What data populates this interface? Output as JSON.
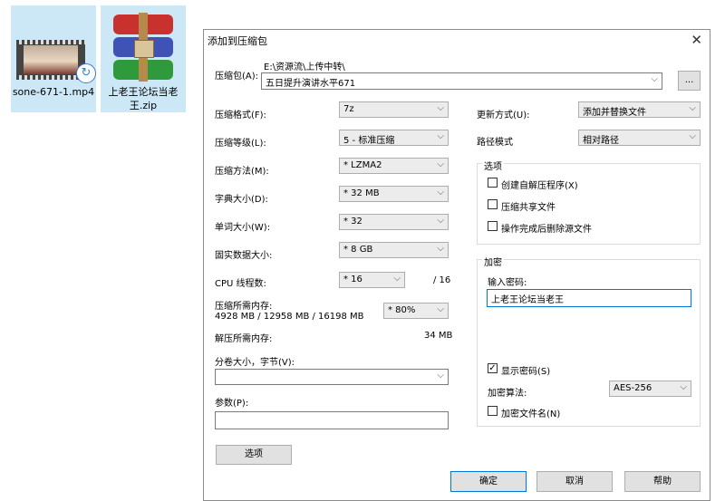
{
  "desktop": {
    "video_file": "sone-671-1.mp4",
    "zip_file": "上老王论坛当老王.zip"
  },
  "dialog": {
    "title": "添加到压缩包",
    "close_glyph": "✕",
    "archive_label": "压缩包(A):",
    "archive_path": "E:\\资源流\\上传中转\\",
    "archive_name": "五日提升演讲水平671",
    "browse_label": "...",
    "format_label": "压缩格式(F):",
    "format_value": "7z",
    "level_label": "压缩等级(L):",
    "level_value": "5 - 标准压缩",
    "method_label": "压缩方法(M):",
    "method_value": "* LZMA2",
    "dict_label": "字典大小(D):",
    "dict_value": "* 32 MB",
    "word_label": "单词大小(W):",
    "word_value": "* 32",
    "solid_label": "固实数据大小:",
    "solid_value": "* 8 GB",
    "cpu_label": "CPU 线程数:",
    "cpu_value": "* 16",
    "cpu_total": "/ 16",
    "mem_comp_label": "压缩所需内存:",
    "mem_comp_value": "4928 MB / 12958 MB / 16198 MB",
    "mem_percent": "* 80%",
    "mem_decomp_label": "解压所需内存:",
    "mem_decomp_value": "34 MB",
    "split_label": "分卷大小，字节(V):",
    "split_value": "",
    "params_label": "参数(P):",
    "params_value": "",
    "options_button": "选项",
    "update_label": "更新方式(U):",
    "update_value": "添加并替换文件",
    "path_label": "路径模式",
    "path_value": "相对路径",
    "options_group": "选项",
    "opt_sfx": "创建自解压程序(X)",
    "opt_shared": "压缩共享文件",
    "opt_delete": "操作完成后删除源文件",
    "enc_group": "加密",
    "pwd_label": "输入密码:",
    "pwd_value": "上老王论坛当老王",
    "show_pwd": "显示密码(S)",
    "show_pwd_checked": true,
    "enc_method_label": "加密算法:",
    "enc_method_value": "AES-256",
    "enc_names": "加密文件名(N)",
    "ok": "确定",
    "cancel": "取消",
    "help": "帮助",
    "dropdown_glyph": "⌵",
    "check_glyph": "✓"
  }
}
